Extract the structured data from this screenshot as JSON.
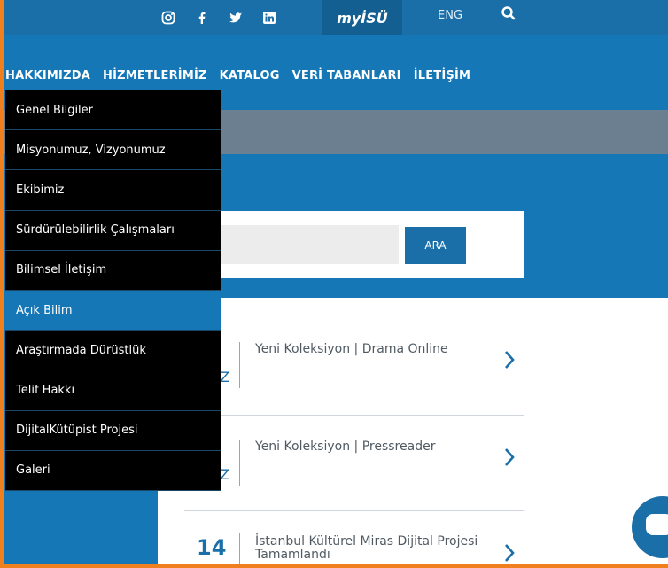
{
  "topbar": {
    "social_icons": [
      "instagram-icon",
      "facebook-icon",
      "twitter-icon",
      "linkedin-icon"
    ],
    "myisu_label": "myİSÜ",
    "lang_label": "ENG"
  },
  "nav": {
    "items": [
      "HAKKIMIZDA",
      "HİZMETLERİMİZ",
      "KATALOG",
      "VERİ TABANLARI",
      "İLETİŞİM"
    ]
  },
  "dropdown": {
    "items": [
      "Genel Bilgiler",
      "Misyonumuz, Vizyonumuz",
      "Ekibimiz",
      "Sürdürülebilirlik Çalışmaları",
      "Bilimsel İletişim",
      "Açık Bilim",
      "Araştırmada Dürüstlük",
      "Telif Hakkı",
      "DijitalKütüpist Projesi",
      "Galeri"
    ],
    "active_index": 5
  },
  "search": {
    "placeholder": "",
    "button_label": "ARA"
  },
  "news": [
    {
      "date": "",
      "month": "Z",
      "title": "Yeni Koleksiyon | Drama Online"
    },
    {
      "date": "",
      "month": "Z",
      "title": "Yeni Koleksiyon | Pressreader"
    },
    {
      "date": "14",
      "month": "",
      "title": "İstanbul Kültürel Miras Dijital Projesi Tamamlandı"
    }
  ],
  "colors": {
    "primary_blue": "#1677b7",
    "dark_blue": "#1a6fa9",
    "accent_orange": "#f07f1d",
    "grey_band": "#6b7f90"
  }
}
